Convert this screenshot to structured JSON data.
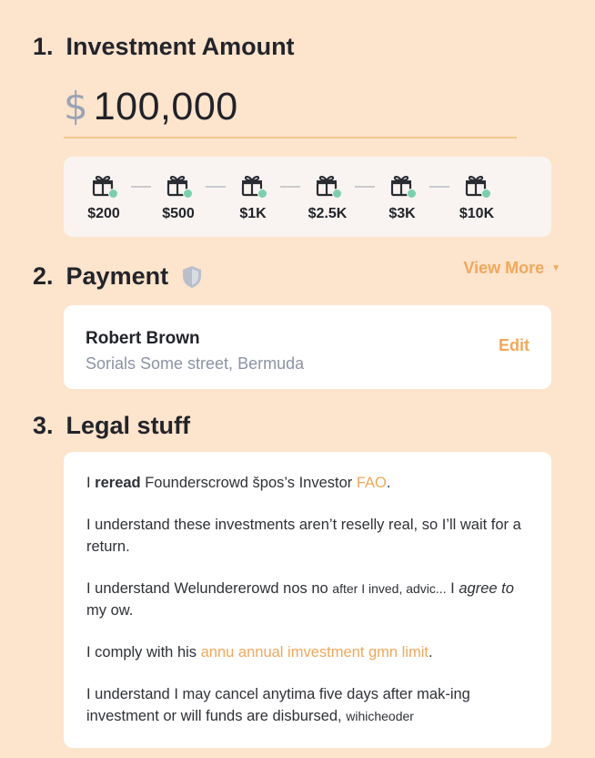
{
  "investment": {
    "number": "1.",
    "title": "Investment Amount",
    "currency": "$",
    "amount": "100,000",
    "presets": [
      "$200",
      "$500",
      "$1K",
      "$2.5K",
      "$3K",
      "$10K"
    ]
  },
  "payment": {
    "number": "2.",
    "title": "Payment",
    "view_more": "View More",
    "name": "Robert Brown",
    "address": "Sorials Some street, Bermuda",
    "edit": "Edit"
  },
  "legal": {
    "number": "3.",
    "title": "Legal stuff",
    "items": [
      {
        "a": "I ",
        "b": "reread",
        "c": " Founderscrowd špos’s Investor ",
        "link": "FAO",
        "d": "."
      },
      {
        "text": "I understand these investments aren’t reselly real, so I’ll wait for a return."
      },
      {
        "a": "I understand Welundererowd nos no ",
        "small": "after I inved, advic...",
        "c": " I ",
        "italic": "agree to",
        "d": " my ow."
      },
      {
        "a": "I comply with his ",
        "link": "annu annual imvestment gmn limit",
        "d": "."
      },
      {
        "a": "I understand I may cancel anytima five days after mak-ing investment or will funds are disbursed, ",
        "small": "wihicheoder"
      }
    ]
  },
  "colors": {
    "accent": "#f0a85c",
    "background": "#fde4cc",
    "badge": "#7ccfae"
  },
  "icons": {
    "preset": "gift-icon",
    "secure": "shield-icon",
    "expand": "chevron-down-icon"
  }
}
